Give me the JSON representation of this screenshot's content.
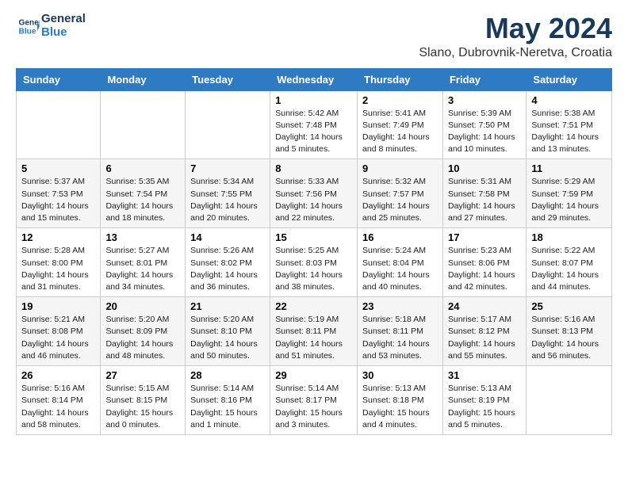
{
  "header": {
    "logo_line1": "General",
    "logo_line2": "Blue",
    "month_year": "May 2024",
    "location": "Slano, Dubrovnik-Neretva, Croatia"
  },
  "weekdays": [
    "Sunday",
    "Monday",
    "Tuesday",
    "Wednesday",
    "Thursday",
    "Friday",
    "Saturday"
  ],
  "weeks": [
    [
      {
        "day": "",
        "info": ""
      },
      {
        "day": "",
        "info": ""
      },
      {
        "day": "",
        "info": ""
      },
      {
        "day": "1",
        "info": "Sunrise: 5:42 AM\nSunset: 7:48 PM\nDaylight: 14 hours\nand 5 minutes."
      },
      {
        "day": "2",
        "info": "Sunrise: 5:41 AM\nSunset: 7:49 PM\nDaylight: 14 hours\nand 8 minutes."
      },
      {
        "day": "3",
        "info": "Sunrise: 5:39 AM\nSunset: 7:50 PM\nDaylight: 14 hours\nand 10 minutes."
      },
      {
        "day": "4",
        "info": "Sunrise: 5:38 AM\nSunset: 7:51 PM\nDaylight: 14 hours\nand 13 minutes."
      }
    ],
    [
      {
        "day": "5",
        "info": "Sunrise: 5:37 AM\nSunset: 7:53 PM\nDaylight: 14 hours\nand 15 minutes."
      },
      {
        "day": "6",
        "info": "Sunrise: 5:35 AM\nSunset: 7:54 PM\nDaylight: 14 hours\nand 18 minutes."
      },
      {
        "day": "7",
        "info": "Sunrise: 5:34 AM\nSunset: 7:55 PM\nDaylight: 14 hours\nand 20 minutes."
      },
      {
        "day": "8",
        "info": "Sunrise: 5:33 AM\nSunset: 7:56 PM\nDaylight: 14 hours\nand 22 minutes."
      },
      {
        "day": "9",
        "info": "Sunrise: 5:32 AM\nSunset: 7:57 PM\nDaylight: 14 hours\nand 25 minutes."
      },
      {
        "day": "10",
        "info": "Sunrise: 5:31 AM\nSunset: 7:58 PM\nDaylight: 14 hours\nand 27 minutes."
      },
      {
        "day": "11",
        "info": "Sunrise: 5:29 AM\nSunset: 7:59 PM\nDaylight: 14 hours\nand 29 minutes."
      }
    ],
    [
      {
        "day": "12",
        "info": "Sunrise: 5:28 AM\nSunset: 8:00 PM\nDaylight: 14 hours\nand 31 minutes."
      },
      {
        "day": "13",
        "info": "Sunrise: 5:27 AM\nSunset: 8:01 PM\nDaylight: 14 hours\nand 34 minutes."
      },
      {
        "day": "14",
        "info": "Sunrise: 5:26 AM\nSunset: 8:02 PM\nDaylight: 14 hours\nand 36 minutes."
      },
      {
        "day": "15",
        "info": "Sunrise: 5:25 AM\nSunset: 8:03 PM\nDaylight: 14 hours\nand 38 minutes."
      },
      {
        "day": "16",
        "info": "Sunrise: 5:24 AM\nSunset: 8:04 PM\nDaylight: 14 hours\nand 40 minutes."
      },
      {
        "day": "17",
        "info": "Sunrise: 5:23 AM\nSunset: 8:06 PM\nDaylight: 14 hours\nand 42 minutes."
      },
      {
        "day": "18",
        "info": "Sunrise: 5:22 AM\nSunset: 8:07 PM\nDaylight: 14 hours\nand 44 minutes."
      }
    ],
    [
      {
        "day": "19",
        "info": "Sunrise: 5:21 AM\nSunset: 8:08 PM\nDaylight: 14 hours\nand 46 minutes."
      },
      {
        "day": "20",
        "info": "Sunrise: 5:20 AM\nSunset: 8:09 PM\nDaylight: 14 hours\nand 48 minutes."
      },
      {
        "day": "21",
        "info": "Sunrise: 5:20 AM\nSunset: 8:10 PM\nDaylight: 14 hours\nand 50 minutes."
      },
      {
        "day": "22",
        "info": "Sunrise: 5:19 AM\nSunset: 8:11 PM\nDaylight: 14 hours\nand 51 minutes."
      },
      {
        "day": "23",
        "info": "Sunrise: 5:18 AM\nSunset: 8:11 PM\nDaylight: 14 hours\nand 53 minutes."
      },
      {
        "day": "24",
        "info": "Sunrise: 5:17 AM\nSunset: 8:12 PM\nDaylight: 14 hours\nand 55 minutes."
      },
      {
        "day": "25",
        "info": "Sunrise: 5:16 AM\nSunset: 8:13 PM\nDaylight: 14 hours\nand 56 minutes."
      }
    ],
    [
      {
        "day": "26",
        "info": "Sunrise: 5:16 AM\nSunset: 8:14 PM\nDaylight: 14 hours\nand 58 minutes."
      },
      {
        "day": "27",
        "info": "Sunrise: 5:15 AM\nSunset: 8:15 PM\nDaylight: 15 hours\nand 0 minutes."
      },
      {
        "day": "28",
        "info": "Sunrise: 5:14 AM\nSunset: 8:16 PM\nDaylight: 15 hours\nand 1 minute."
      },
      {
        "day": "29",
        "info": "Sunrise: 5:14 AM\nSunset: 8:17 PM\nDaylight: 15 hours\nand 3 minutes."
      },
      {
        "day": "30",
        "info": "Sunrise: 5:13 AM\nSunset: 8:18 PM\nDaylight: 15 hours\nand 4 minutes."
      },
      {
        "day": "31",
        "info": "Sunrise: 5:13 AM\nSunset: 8:19 PM\nDaylight: 15 hours\nand 5 minutes."
      },
      {
        "day": "",
        "info": ""
      }
    ]
  ]
}
